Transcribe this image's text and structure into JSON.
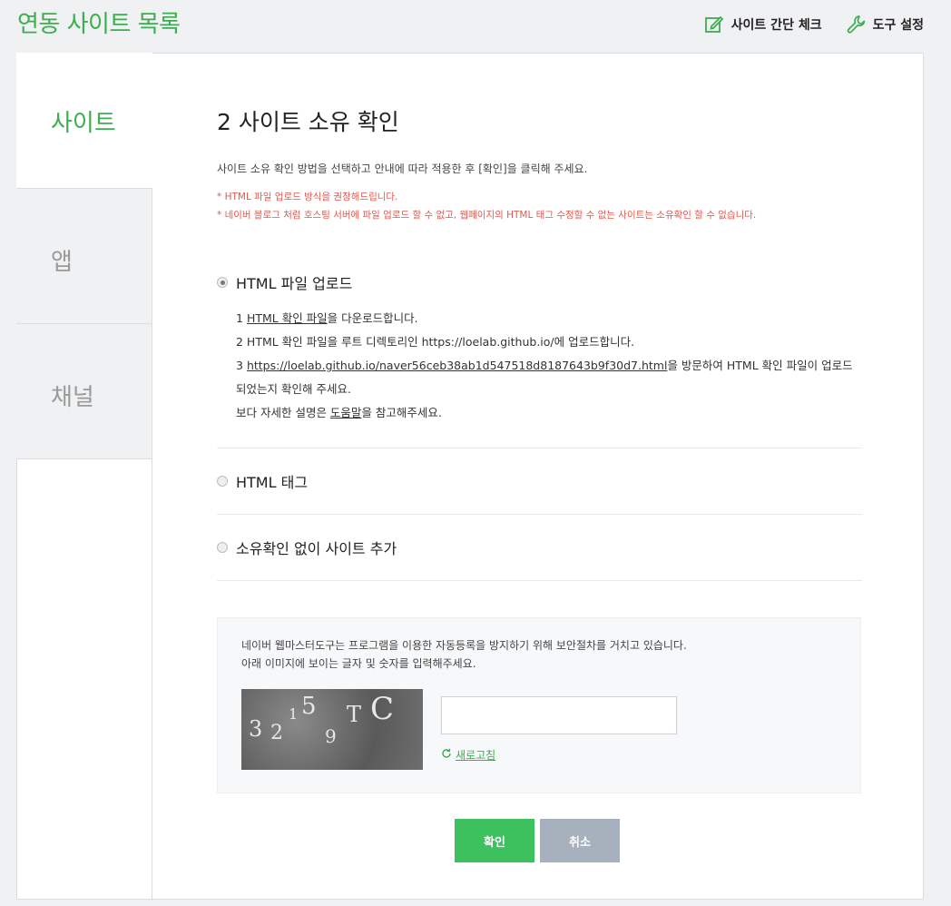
{
  "header": {
    "title": "연동 사이트 목록",
    "actions": [
      {
        "label": "사이트 간단 체크",
        "icon": "edit-icon"
      },
      {
        "label": "도구 설정",
        "icon": "wrench-icon"
      }
    ]
  },
  "sidebar": {
    "tabs": [
      {
        "label": "사이트",
        "active": true
      },
      {
        "label": "앱",
        "active": false
      },
      {
        "label": "채널",
        "active": false
      }
    ]
  },
  "main": {
    "title": "2 사이트 소유 확인",
    "description": "사이트 소유 확인 방법을 선택하고 안내에 따라 적용한 후 [확인]을 클릭해 주세요.",
    "notes": [
      "* HTML 파일 업로드 방식을 권장해드립니다.",
      "* 네이버 블로그 처럼 호스팅 서버에 파일 업로드 할 수 없고, 웹페이지의 HTML 태그 수정할 수 없는 사이트는 소유확인 할 수 없습니다."
    ],
    "options": [
      {
        "label": "HTML 파일 업로드",
        "checked": true
      },
      {
        "label": "HTML 태그",
        "checked": false
      },
      {
        "label": "소유확인 없이 사이트 추가",
        "checked": false
      }
    ],
    "steps": {
      "s1_num": "1 ",
      "s1_link": "HTML 확인 파일",
      "s1_rest": "을 다운로드합니다.",
      "s2": "2 HTML 확인 파일을 루트 디렉토리인 https://loelab.github.io/에 업로드합니다.",
      "s3_num": "3 ",
      "s3_link": "https://loelab.github.io/naver56ceb38ab1d547518d8187643b9f30d7.html",
      "s3_rest": "을 방문하여 HTML 확인 파일이 업로드",
      "s3_cont": "되었는지 확인해 주세요.",
      "s4_pre": "보다 자세한 설명은 ",
      "s4_link": "도움말",
      "s4_rest": "을 참고해주세요."
    },
    "captcha": {
      "line1": "네이버 웹마스터도구는 프로그램을 이용한 자동등록을 방지하기 위해 보안절차를 거치고 있습니다.",
      "line2": "아래 이미지에 보이는 글자 및 숫자를 입력해주세요.",
      "image_text": "32159TC",
      "input_value": "",
      "refresh_label": "새로고침"
    },
    "buttons": {
      "ok": "확인",
      "cancel": "취소"
    }
  },
  "colors": {
    "accent": "#3bae4f",
    "ok_button": "#3cc15e",
    "cancel_button": "#a7b1bd",
    "note": "#e0594f"
  }
}
